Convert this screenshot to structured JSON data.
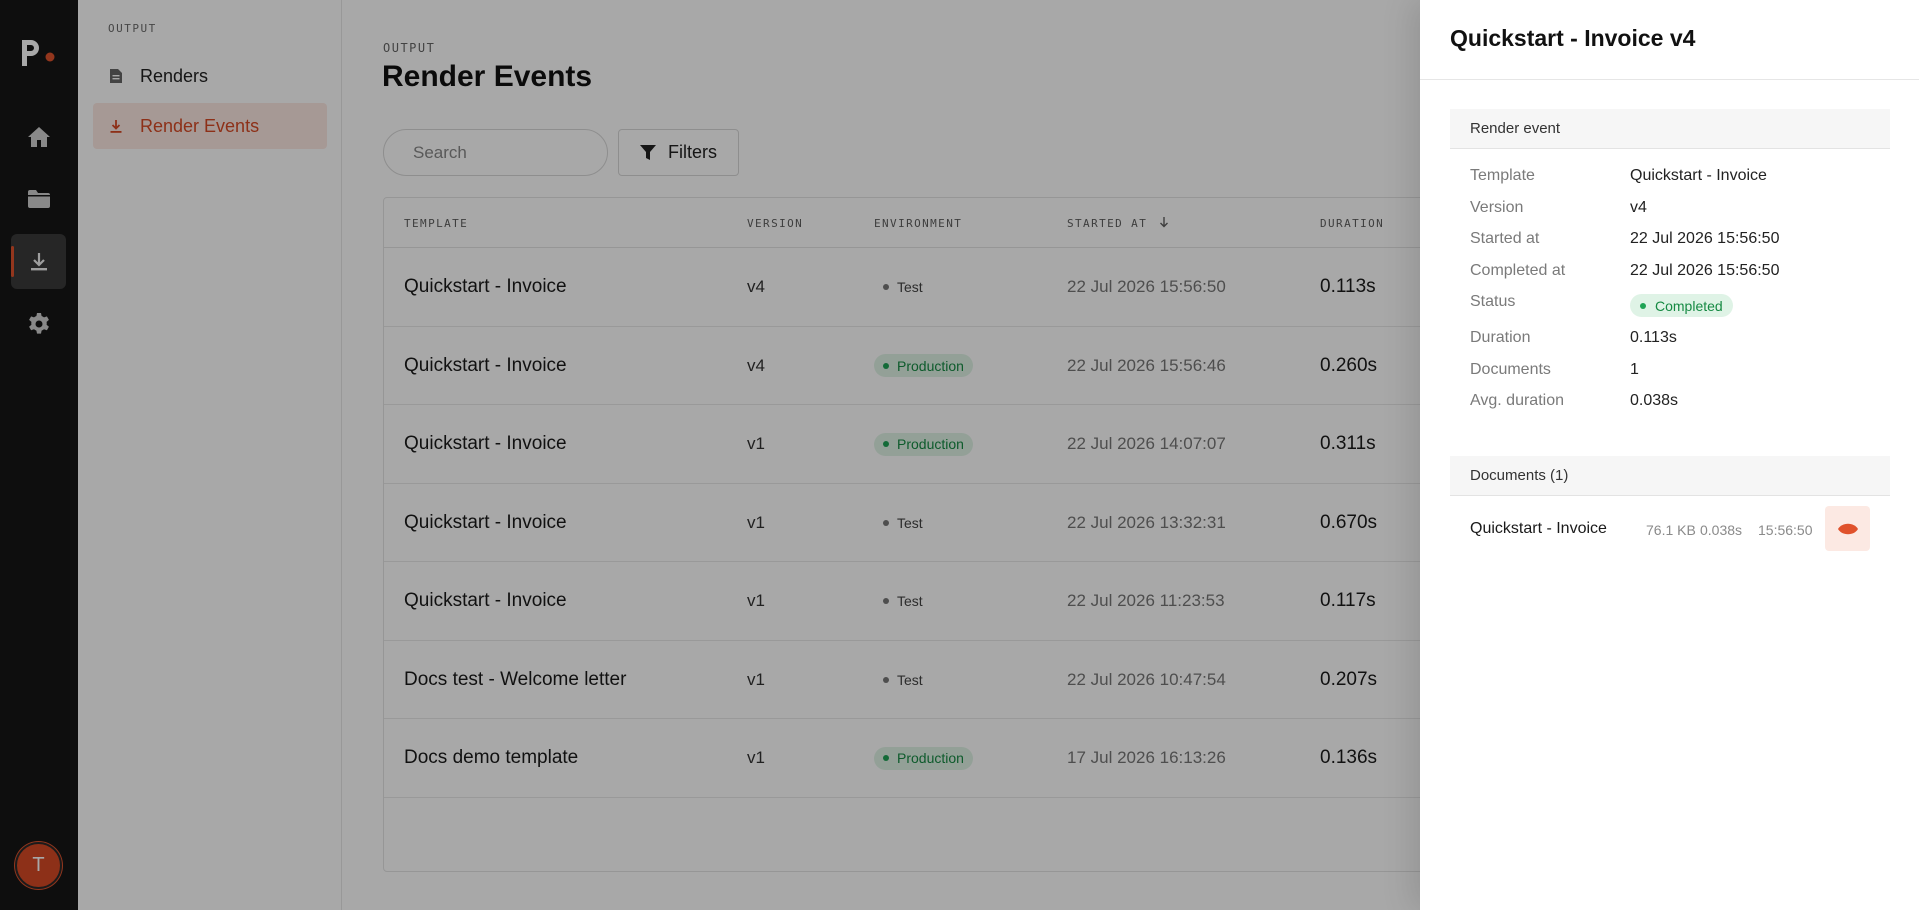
{
  "app": {
    "avatar_initial": "T",
    "accent": "#d74a25"
  },
  "rail": {
    "items": [
      "home-icon",
      "folder-icon",
      "download-icon",
      "gear-icon"
    ],
    "active": "download-icon"
  },
  "subnav": {
    "heading": "OUTPUT",
    "items": [
      {
        "label": "Renders",
        "icon": "document-icon",
        "active": false
      },
      {
        "label": "Render Events",
        "icon": "download-icon",
        "active": true
      }
    ]
  },
  "main": {
    "eyebrow": "OUTPUT",
    "title": "Render Events",
    "search_placeholder": "Search",
    "filters_label": "Filters",
    "columns": {
      "template": "TEMPLATE",
      "version": "VERSION",
      "environment": "ENVIRONMENT",
      "started_at": "STARTED AT",
      "duration": "DURATION"
    },
    "sort": {
      "column": "STARTED AT",
      "direction": "descending"
    },
    "rows": [
      {
        "template": "Quickstart - Invoice",
        "version": "v4",
        "environment": "Test",
        "env_kind": "test",
        "started_at": "22 Jul 2026 15:56:50",
        "duration": "0.113s"
      },
      {
        "template": "Quickstart - Invoice",
        "version": "v4",
        "environment": "Production",
        "env_kind": "production",
        "started_at": "22 Jul 2026 15:56:46",
        "duration": "0.260s"
      },
      {
        "template": "Quickstart - Invoice",
        "version": "v1",
        "environment": "Production",
        "env_kind": "production",
        "started_at": "22 Jul 2026 14:07:07",
        "duration": "0.311s"
      },
      {
        "template": "Quickstart - Invoice",
        "version": "v1",
        "environment": "Test",
        "env_kind": "test",
        "started_at": "22 Jul 2026 13:32:31",
        "duration": "0.670s"
      },
      {
        "template": "Quickstart - Invoice",
        "version": "v1",
        "environment": "Test",
        "env_kind": "test",
        "started_at": "22 Jul 2026 11:23:53",
        "duration": "0.117s"
      },
      {
        "template": "Docs test - Welcome letter",
        "version": "v1",
        "environment": "Test",
        "env_kind": "test",
        "started_at": "22 Jul 2026 10:47:54",
        "duration": "0.207s"
      },
      {
        "template": "Docs demo template",
        "version": "v1",
        "environment": "Production",
        "env_kind": "production",
        "started_at": "17 Jul 2026 16:13:26",
        "duration": "0.136s"
      }
    ]
  },
  "drawer": {
    "title": "Quickstart - Invoice v4",
    "event_section": "Render event",
    "fields": [
      {
        "label": "Template",
        "value": "Quickstart - Invoice"
      },
      {
        "label": "Version",
        "value": "v4"
      },
      {
        "label": "Started at",
        "value": "22 Jul 2026 15:56:50"
      },
      {
        "label": "Completed at",
        "value": "22 Jul 2026 15:56:50"
      },
      {
        "label": "Status",
        "value": "Completed"
      },
      {
        "label": "Duration",
        "value": "0.113s"
      },
      {
        "label": "Documents",
        "value": "1"
      },
      {
        "label": "Avg. duration",
        "value": "0.038s"
      }
    ],
    "documents_section": "Documents (1)",
    "documents": [
      {
        "name": "Quickstart - Invoice",
        "size": "76.1 KB",
        "duration": "0.038s",
        "time": "15:56:50",
        "action_icon": "eye-icon"
      }
    ]
  }
}
